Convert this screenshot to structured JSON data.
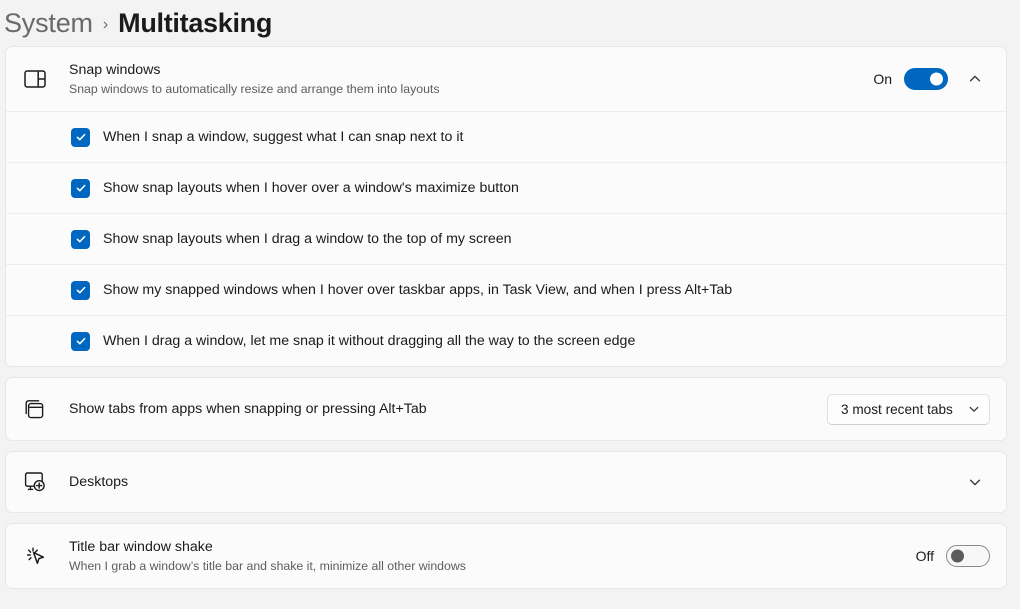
{
  "breadcrumb": {
    "parent": "System",
    "separator": "›",
    "current": "Multitasking"
  },
  "colors": {
    "page_background": "#f3f3f3",
    "card_background": "#fbfbfb",
    "accent": "#0067c0",
    "text_primary": "#1b1b1b",
    "text_secondary": "#5d5d5d",
    "toggle_off_knob": "#5b5b5b"
  },
  "snap_windows": {
    "icon": "snap-layout-icon",
    "title": "Snap windows",
    "subtitle": "Snap windows to automatically resize and arrange them into layouts",
    "toggle_label": "On",
    "toggle_state": "on",
    "expander_icon": "chevron-up-icon",
    "expanded": true,
    "options": [
      {
        "label": "When I snap a window, suggest what I can snap next to it",
        "checked": true
      },
      {
        "label": "Show snap layouts when I hover over a window's maximize button",
        "checked": true
      },
      {
        "label": "Show snap layouts when I drag a window to the top of my screen",
        "checked": true
      },
      {
        "label": "Show my snapped windows when I hover over taskbar apps, in Task View, and when I press Alt+Tab",
        "checked": true
      },
      {
        "label": "When I drag a window, let me snap it without dragging all the way to the screen edge",
        "checked": true
      }
    ]
  },
  "show_tabs": {
    "icon": "stacked-windows-icon",
    "title": "Show tabs from apps when snapping or pressing Alt+Tab",
    "dropdown_value": "3 most recent tabs",
    "dropdown_icon": "chevron-down-icon"
  },
  "desktops": {
    "icon": "new-desktop-icon",
    "title": "Desktops",
    "expander_icon": "chevron-down-icon",
    "expanded": false
  },
  "title_bar_shake": {
    "icon": "cursor-shake-icon",
    "title": "Title bar window shake",
    "subtitle": "When I grab a window’s title bar and shake it, minimize all other windows",
    "toggle_label": "Off",
    "toggle_state": "off"
  }
}
